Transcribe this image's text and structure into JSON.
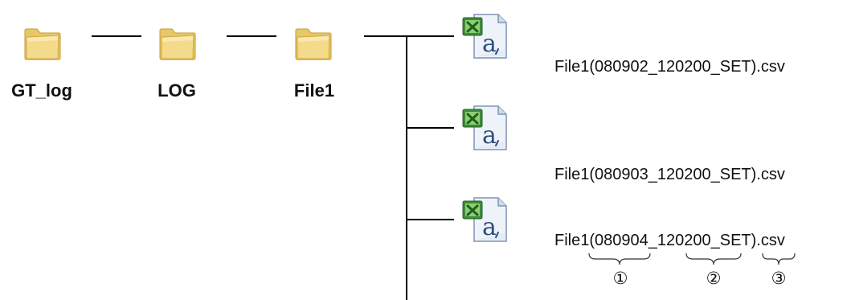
{
  "tree": {
    "folders": [
      {
        "label": "GT_log",
        "icon": "folder-icon"
      },
      {
        "label": "LOG",
        "icon": "folder-icon"
      },
      {
        "label": "File1",
        "icon": "folder-icon"
      }
    ],
    "files": [
      {
        "label": "File1(080902_120200_SET).csv",
        "icon": "excel-csv-icon"
      },
      {
        "label": "File1(080903_120200_SET).csv",
        "icon": "excel-csv-icon"
      },
      {
        "label": "File1(080904_120200_SET).csv",
        "icon": "excel-csv-icon"
      }
    ],
    "annotations": [
      "①",
      "②",
      "③"
    ]
  }
}
